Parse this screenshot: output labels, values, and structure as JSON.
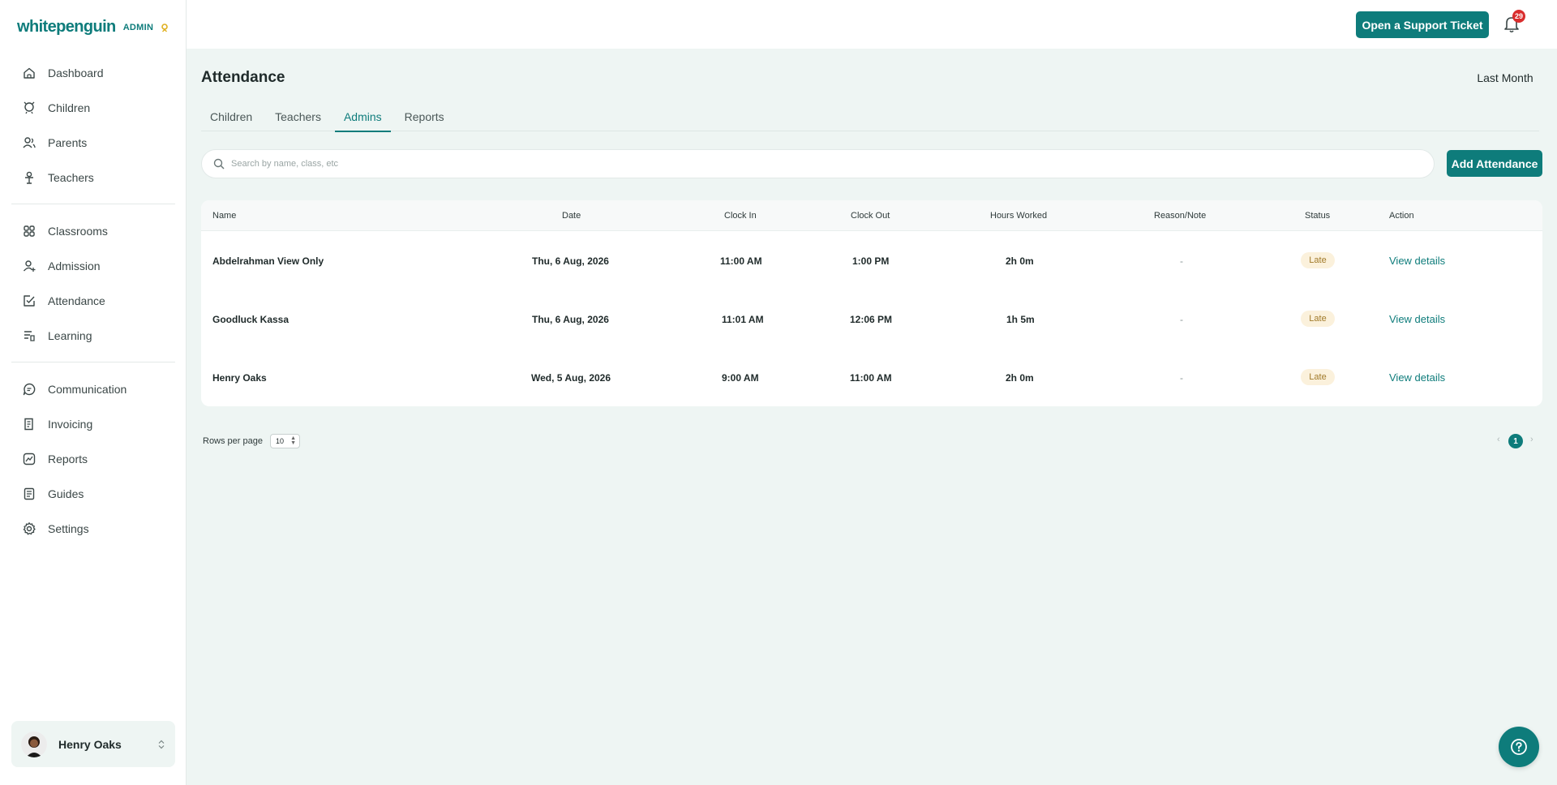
{
  "brand": {
    "logo_text": "whitepenguin",
    "role": "ADMIN",
    "accent": "#0e7c7b"
  },
  "sidebar": {
    "groups": [
      [
        {
          "label": "Dashboard",
          "icon": "home-icon"
        },
        {
          "label": "Children",
          "icon": "child-icon"
        },
        {
          "label": "Parents",
          "icon": "parents-icon"
        },
        {
          "label": "Teachers",
          "icon": "teacher-icon"
        }
      ],
      [
        {
          "label": "Classrooms",
          "icon": "grid-icon"
        },
        {
          "label": "Admission",
          "icon": "admission-icon"
        },
        {
          "label": "Attendance",
          "icon": "checklist-icon"
        },
        {
          "label": "Learning",
          "icon": "learning-icon"
        }
      ],
      [
        {
          "label": "Communication",
          "icon": "chat-icon"
        },
        {
          "label": "Invoicing",
          "icon": "invoice-icon"
        },
        {
          "label": "Reports",
          "icon": "reports-icon"
        },
        {
          "label": "Guides",
          "icon": "guide-icon"
        },
        {
          "label": "Settings",
          "icon": "gear-icon"
        }
      ]
    ],
    "user": {
      "name": "Henry Oaks"
    }
  },
  "topbar": {
    "support_label": "Open a Support Ticket",
    "notification_count": "29"
  },
  "page": {
    "title": "Attendance",
    "range_label": "Last Month"
  },
  "tabs": [
    {
      "label": "Children",
      "active": false
    },
    {
      "label": "Teachers",
      "active": false
    },
    {
      "label": "Admins",
      "active": true
    },
    {
      "label": "Reports",
      "active": false
    }
  ],
  "search": {
    "placeholder": "Search by name, class, etc",
    "value": ""
  },
  "add_attendance_label": "Add Attendance",
  "table": {
    "headers": [
      "Name",
      "Date",
      "Clock In",
      "Clock Out",
      "Hours Worked",
      "Reason/Note",
      "Status",
      "Action"
    ],
    "rows": [
      {
        "name": "Abdelrahman View Only",
        "date": "Thu, 6 Aug, 2026",
        "clock_in": "11:00 AM",
        "clock_out": "1:00 PM",
        "hours": "2h 0m",
        "note": "-",
        "status": "Late",
        "action": "View details"
      },
      {
        "name": "Goodluck Kassa",
        "date": "Thu, 6 Aug, 2026",
        "clock_in": "11:01 AM",
        "clock_out": "12:06 PM",
        "hours": "1h 5m",
        "note": "-",
        "status": "Late",
        "action": "View details"
      },
      {
        "name": "Henry Oaks",
        "date": "Wed, 5 Aug, 2026",
        "clock_in": "9:00 AM",
        "clock_out": "11:00 AM",
        "hours": "2h 0m",
        "note": "-",
        "status": "Late",
        "action": "View details"
      }
    ]
  },
  "pagination": {
    "rows_per_page_label": "Rows per page",
    "rows_per_page": "10",
    "current_page": "1"
  }
}
